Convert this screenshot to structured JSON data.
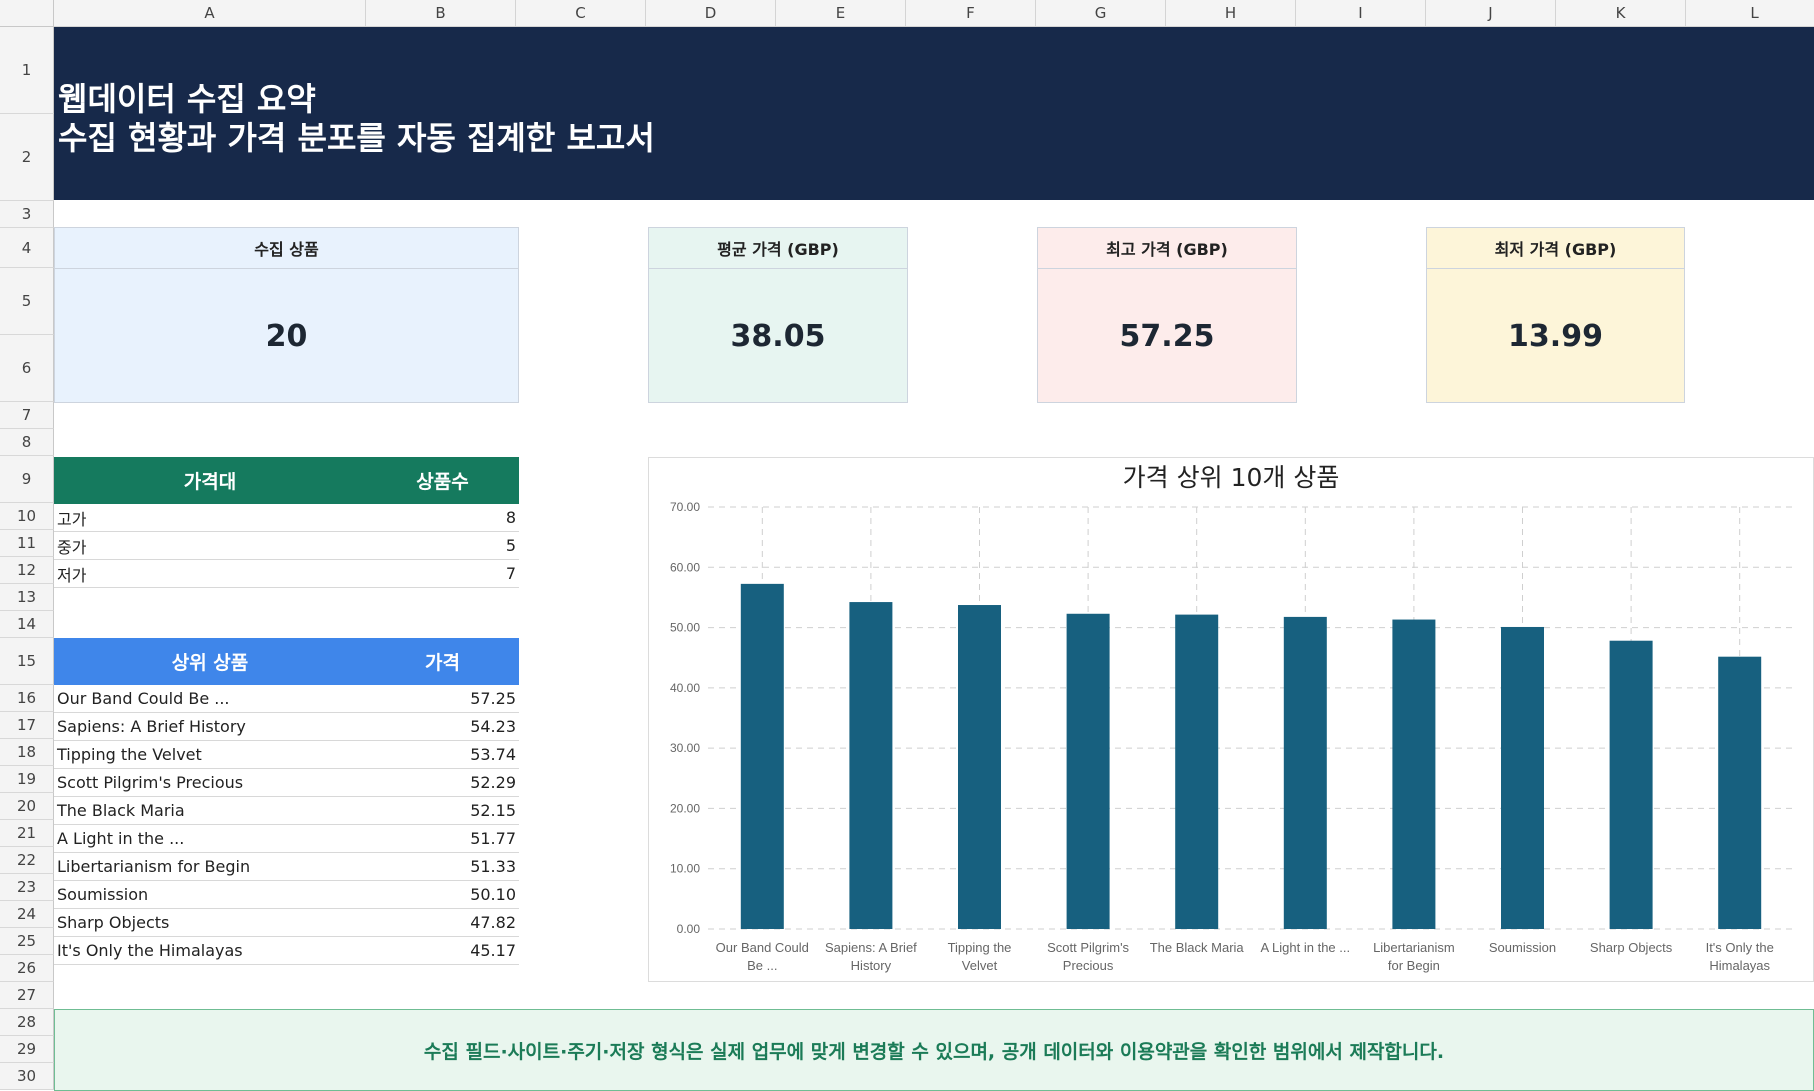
{
  "sheet": {
    "columns": [
      "A",
      "B",
      "C",
      "D",
      "E",
      "F",
      "G",
      "H",
      "I",
      "J",
      "K",
      "L"
    ],
    "rows": [
      "1",
      "2",
      "3",
      "4",
      "5",
      "6",
      "7",
      "8",
      "9",
      "10",
      "11",
      "12",
      "13",
      "14",
      "15",
      "16",
      "17",
      "18",
      "19",
      "20",
      "21",
      "22",
      "23",
      "24",
      "25",
      "26",
      "27",
      "28",
      "29",
      "30"
    ]
  },
  "banner": {
    "title": "웹데이터 수집 요약",
    "subtitle": "수집 현황과 가격 분포를 자동 집계한 보고서",
    "background": "#17294a"
  },
  "kpis": [
    {
      "label": "수집 상품",
      "value": "20",
      "color": "#e8f2fd"
    },
    {
      "label": "평균 가격 (GBP)",
      "value": "38.05",
      "color": "#e7f5f1"
    },
    {
      "label": "최고 가격 (GBP)",
      "value": "57.25",
      "color": "#fdeceb"
    },
    {
      "label": "최저 가격 (GBP)",
      "value": "13.99",
      "color": "#fdf5d9"
    }
  ],
  "price_band": {
    "headers": [
      "가격대",
      "상품수"
    ],
    "header_color": "#157a5e",
    "rows": [
      {
        "label": "고가",
        "count": "8"
      },
      {
        "label": "중가",
        "count": "5"
      },
      {
        "label": "저가",
        "count": "7"
      }
    ]
  },
  "top_products": {
    "headers": [
      "상위 상품",
      "가격"
    ],
    "header_color": "#3f86ea",
    "rows": [
      {
        "name": "Our Band Could Be ...",
        "price": "57.25"
      },
      {
        "name": "Sapiens: A Brief History",
        "price": "54.23"
      },
      {
        "name": "Tipping the Velvet",
        "price": "53.74"
      },
      {
        "name": "Scott Pilgrim's Precious",
        "price": "52.29"
      },
      {
        "name": "The Black Maria",
        "price": "52.15"
      },
      {
        "name": "A Light in the ...",
        "price": "51.77"
      },
      {
        "name": "Libertarianism for Begin",
        "price": "51.33"
      },
      {
        "name": "Soumission",
        "price": "50.10"
      },
      {
        "name": "Sharp Objects",
        "price": "47.82"
      },
      {
        "name": "It's Only the Himalayas",
        "price": "45.17"
      }
    ]
  },
  "chart_data": {
    "type": "bar",
    "title": "가격 상위 10개 상품",
    "categories": [
      [
        "Our Band Could",
        "Be ..."
      ],
      [
        "Sapiens: A Brief",
        "History"
      ],
      [
        "Tipping the",
        "Velvet"
      ],
      [
        "Scott Pilgrim's",
        "Precious"
      ],
      [
        "The Black Maria"
      ],
      [
        "A Light in the ..."
      ],
      [
        "Libertarianism",
        "for Begin"
      ],
      [
        "Soumission"
      ],
      [
        "Sharp Objects"
      ],
      [
        "It's Only the",
        "Himalayas"
      ]
    ],
    "values": [
      57.25,
      54.23,
      53.74,
      52.29,
      52.15,
      51.77,
      51.33,
      50.1,
      47.82,
      45.17
    ],
    "ylim": [
      0,
      70
    ],
    "yticks": [
      "0.00",
      "10.00",
      "20.00",
      "30.00",
      "40.00",
      "50.00",
      "60.00",
      "70.00"
    ],
    "grid": true,
    "bar_color": "#17607f"
  },
  "note": {
    "text": "수집 필드·사이트·주기·저장 형식은 실제 업무에 맞게 변경할 수 있으며, 공개 데이터와 이용약관을 확인한 범위에서 제작합니다."
  }
}
